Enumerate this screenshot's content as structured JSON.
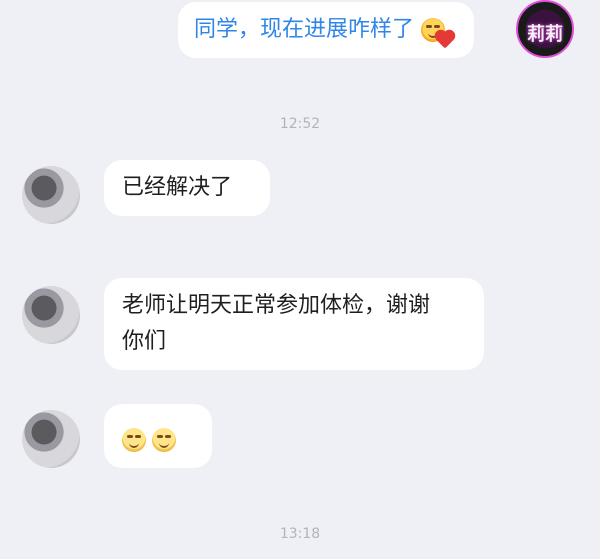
{
  "messages": [
    {
      "id": "m1",
      "direction": "out",
      "text": "同学，现在进展咋样了",
      "emoji": "blushing-heart-icon"
    },
    {
      "id": "t1",
      "type": "timestamp",
      "text": "12:52"
    },
    {
      "id": "m2",
      "direction": "in",
      "text": "已经解决了"
    },
    {
      "id": "m3",
      "direction": "in",
      "line1": "老师让明天正常参加体检，谢谢",
      "line2": "你们"
    },
    {
      "id": "m4",
      "direction": "in",
      "emojis": [
        "smiling-face-icon",
        "smiling-face-icon"
      ]
    },
    {
      "id": "t2",
      "type": "timestamp",
      "text": "13:18"
    }
  ],
  "avatars": {
    "self": {
      "text": "莉莉",
      "color": "#e04fd8"
    },
    "contact": {
      "text": ""
    }
  },
  "colors": {
    "background": "#eef0f6",
    "bubble": "#ffffff",
    "outgoing_text": "#2f86e8",
    "incoming_text": "#1f1f1f",
    "timestamp": "#b2b4ba"
  }
}
